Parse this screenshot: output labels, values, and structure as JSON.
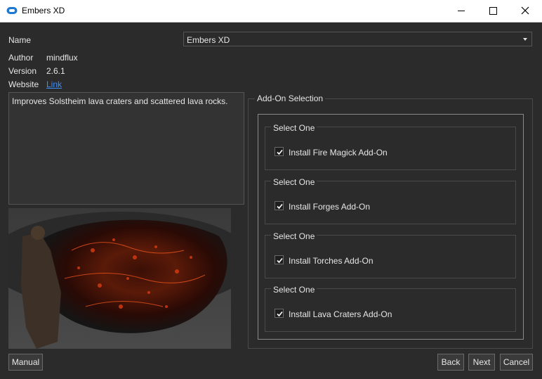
{
  "window": {
    "title": "Embers XD",
    "icon": "cloud-app-icon"
  },
  "info": {
    "name_label": "Name",
    "name_value": "Embers XD",
    "author_label": "Author",
    "author_value": "mindflux",
    "version_label": "Version",
    "version_value": "2.6.1",
    "website_label": "Website",
    "website_link": "Link"
  },
  "description": "Improves Solstheim lava craters and scattered lava rocks.",
  "addons": {
    "title": "Add-On Selection",
    "groups": [
      {
        "title": "Select One",
        "option": "Install Fire Magick Add-On",
        "checked": true
      },
      {
        "title": "Select One",
        "option": "Install Forges Add-On",
        "checked": true
      },
      {
        "title": "Select One",
        "option": "Install Torches Add-On",
        "checked": true
      },
      {
        "title": "Select One",
        "option": "Install Lava Craters Add-On",
        "checked": true
      }
    ]
  },
  "buttons": {
    "manual": "Manual",
    "back": "Back",
    "next": "Next",
    "cancel": "Cancel"
  },
  "colors": {
    "background": "#2b2b2b",
    "link": "#3e8ef7",
    "icon_blue": "#1e78d2"
  }
}
